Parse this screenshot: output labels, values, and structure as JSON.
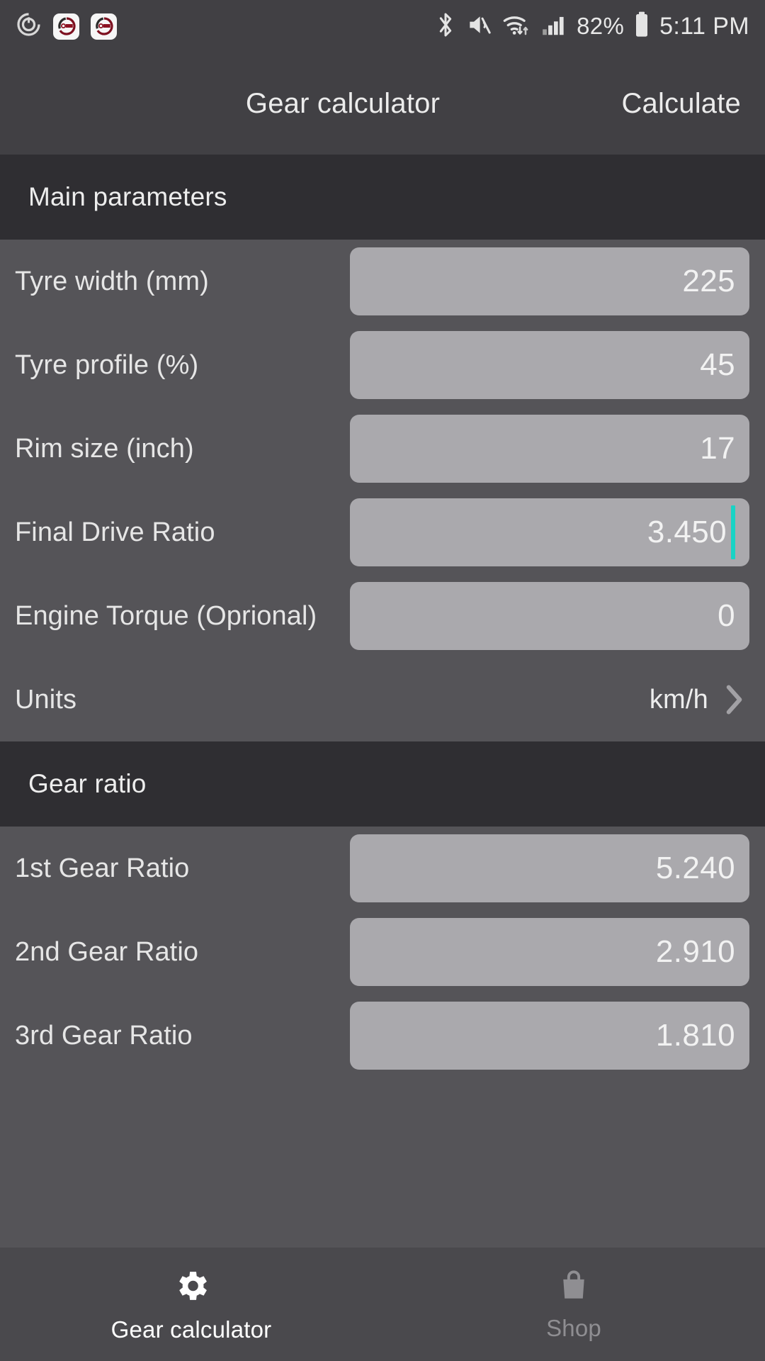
{
  "status_bar": {
    "left_icons": [
      "power-ring-icon",
      "app-badge-icon",
      "app-badge-icon"
    ],
    "right_icons": [
      "bluetooth-icon",
      "mute-icon",
      "wifi-icon",
      "signal-icon",
      "battery-icon"
    ],
    "battery_percent": "82%",
    "time": "5:11 PM"
  },
  "app_bar": {
    "title": "Gear calculator",
    "action_label": "Calculate"
  },
  "sections": [
    {
      "header": "Main parameters",
      "rows": [
        {
          "label": "Tyre width (mm)",
          "value": "225",
          "type": "input",
          "focused": false
        },
        {
          "label": "Tyre profile (%)",
          "value": "45",
          "type": "input",
          "focused": false
        },
        {
          "label": "Rim size (inch)",
          "value": "17",
          "type": "input",
          "focused": false
        },
        {
          "label": "Final Drive Ratio",
          "value": "3.450",
          "type": "input",
          "focused": true
        },
        {
          "label": "Engine Torque (Oprional)",
          "value": "0",
          "type": "input",
          "focused": false
        },
        {
          "label": "Units",
          "value": "km/h",
          "type": "nav",
          "focused": false
        }
      ]
    },
    {
      "header": "Gear ratio",
      "rows": [
        {
          "label": "1st Gear Ratio",
          "value": "5.240",
          "type": "input",
          "focused": false
        },
        {
          "label": "2nd Gear Ratio",
          "value": "2.910",
          "type": "input",
          "focused": false
        },
        {
          "label": "3rd Gear Ratio",
          "value": "1.810",
          "type": "input",
          "focused": false
        }
      ]
    }
  ],
  "bottom_nav": [
    {
      "label": "Gear calculator",
      "icon": "gear-icon",
      "active": true
    },
    {
      "label": "Shop",
      "icon": "shopping-bag-icon",
      "active": false
    }
  ],
  "colors": {
    "caret": "#19d3c5",
    "field_bg": "#aaa9ad",
    "page_bg": "#555458",
    "bar_bg": "#414044",
    "section_bg": "#2f2e32"
  }
}
